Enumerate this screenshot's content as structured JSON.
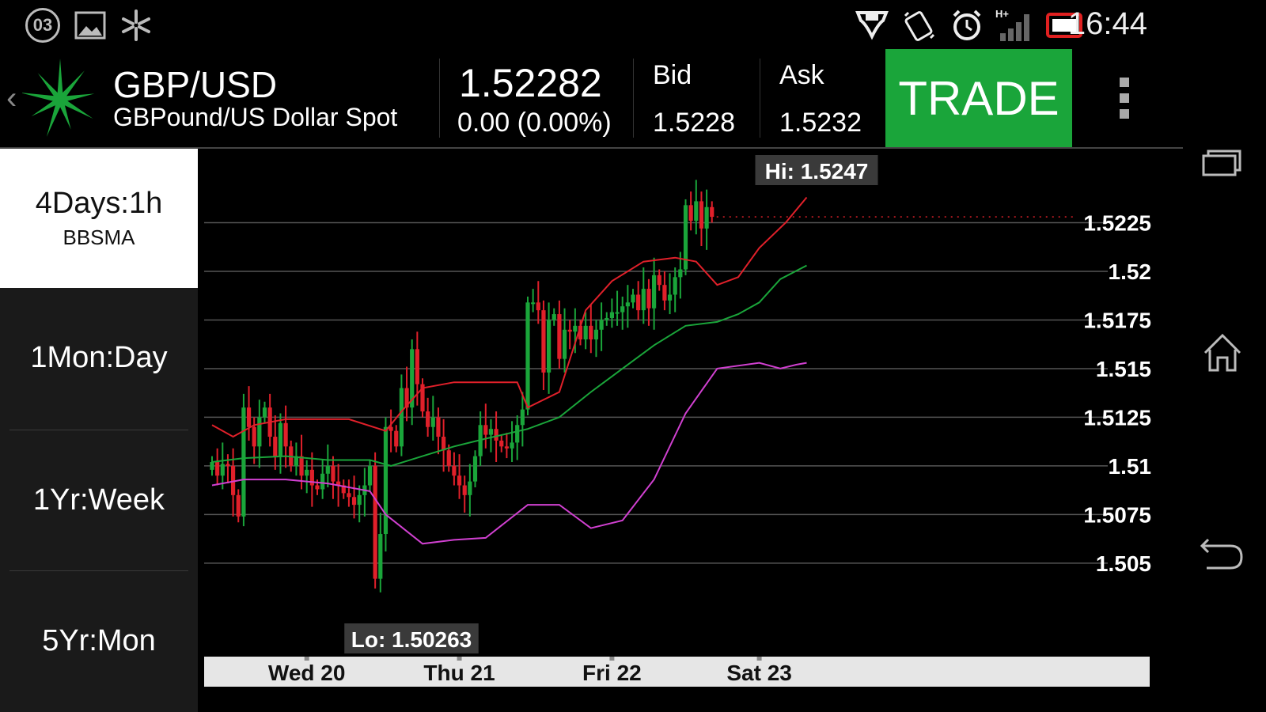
{
  "status_bar": {
    "notification_badge": "03",
    "time": "16:44",
    "network_label": "H+"
  },
  "header": {
    "symbol": "GBP/USD",
    "description": "GBPound/US Dollar Spot",
    "last_price": "1.52282",
    "change": "0.00 (0.00%)",
    "bid_label": "Bid",
    "bid_value": "1.5228",
    "ask_label": "Ask",
    "ask_value": "1.5232",
    "trade_label": "TRADE",
    "trade_color": "#1aa53a"
  },
  "range_menu": [
    {
      "label": "4Days:1h",
      "sub": "BBSMA",
      "active": true
    },
    {
      "label": "1Mon:Day",
      "sub": "",
      "active": false
    },
    {
      "label": "1Yr:Week",
      "sub": "",
      "active": false
    },
    {
      "label": "5Yr:Mon",
      "sub": "",
      "active": false
    }
  ],
  "chart_data": {
    "type": "candlestick",
    "ylim": [
      1.5015,
      1.5263
    ],
    "y_ticks": [
      "1.5225",
      "1.52",
      "1.5175",
      "1.515",
      "1.5125",
      "1.51",
      "1.5075",
      "1.505"
    ],
    "y_tick_values": [
      1.5225,
      1.52,
      1.5175,
      1.515,
      1.5125,
      1.51,
      1.5075,
      1.505
    ],
    "x_labels": [
      "Wed 20",
      "Thu 21",
      "Fri 22",
      "Sat 23"
    ],
    "x_label_candle_index": [
      18,
      47,
      76,
      104
    ],
    "hi_label": "Hi: 1.5247",
    "lo_label": "Lo: 1.50263",
    "last_value": 1.5228,
    "up_color": "#1aa53a",
    "down_color": "#e0202a",
    "upper_band_color": "#e0202a",
    "sma_color": "#1aa53a",
    "lower_band_color": "#d040d0",
    "closes": [
      1.5102,
      1.5095,
      1.5101,
      1.51,
      1.5085,
      1.5074,
      1.513,
      1.512,
      1.511,
      1.5125,
      1.513,
      1.5115,
      1.5105,
      1.5122,
      1.511,
      1.51,
      1.5105,
      1.5095,
      1.5098,
      1.509,
      1.5088,
      1.5096,
      1.51,
      1.5092,
      1.509,
      1.5086,
      1.5084,
      1.508,
      1.5085,
      1.509,
      1.51,
      1.5042,
      1.5065,
      1.512,
      1.5118,
      1.511,
      1.514,
      1.513,
      1.516,
      1.5142,
      1.5128,
      1.512,
      1.5125,
      1.5115,
      1.5108,
      1.51,
      1.5095,
      1.509,
      1.5085,
      1.5092,
      1.5105,
      1.5121,
      1.5116,
      1.5119,
      1.5113,
      1.511,
      1.5109,
      1.5112,
      1.5121,
      1.5129,
      1.5184,
      1.5184,
      1.518,
      1.5148,
      1.5175,
      1.5178,
      1.5155,
      1.517,
      1.5169,
      1.5172,
      1.5165,
      1.5172,
      1.5165,
      1.517,
      1.5175,
      1.5176,
      1.5179,
      1.5179,
      1.5182,
      1.5184,
      1.5188,
      1.518,
      1.5191,
      1.5181,
      1.5198,
      1.5193,
      1.5185,
      1.5188,
      1.5197,
      1.5201,
      1.5234,
      1.5226,
      1.5236,
      1.5222,
      1.5233,
      1.5228
    ],
    "upper_band": [
      [
        0,
        1.5121
      ],
      [
        4,
        1.5115
      ],
      [
        8,
        1.5121
      ],
      [
        14,
        1.5124
      ],
      [
        26,
        1.5124
      ],
      [
        33,
        1.5118
      ],
      [
        36,
        1.5128
      ],
      [
        40,
        1.514
      ],
      [
        46,
        1.5143
      ],
      [
        58,
        1.5143
      ],
      [
        60,
        1.513
      ],
      [
        66,
        1.5138
      ],
      [
        71,
        1.518
      ],
      [
        76,
        1.5195
      ],
      [
        82,
        1.5205
      ],
      [
        88,
        1.5207
      ],
      [
        92,
        1.5205
      ],
      [
        96,
        1.5193
      ],
      [
        100,
        1.5197
      ],
      [
        104,
        1.5212
      ],
      [
        109,
        1.5225
      ],
      [
        113,
        1.5238
      ]
    ],
    "sma": [
      [
        0,
        1.5102
      ],
      [
        6,
        1.5104
      ],
      [
        14,
        1.5105
      ],
      [
        22,
        1.5103
      ],
      [
        30,
        1.5103
      ],
      [
        34,
        1.51
      ],
      [
        40,
        1.5105
      ],
      [
        46,
        1.511
      ],
      [
        52,
        1.5114
      ],
      [
        60,
        1.5119
      ],
      [
        66,
        1.5125
      ],
      [
        72,
        1.5138
      ],
      [
        78,
        1.515
      ],
      [
        84,
        1.5162
      ],
      [
        90,
        1.5172
      ],
      [
        96,
        1.5174
      ],
      [
        100,
        1.5178
      ],
      [
        104,
        1.5184
      ],
      [
        108,
        1.5196
      ],
      [
        113,
        1.5203
      ]
    ],
    "lower_band": [
      [
        0,
        1.509
      ],
      [
        6,
        1.5093
      ],
      [
        14,
        1.5093
      ],
      [
        22,
        1.5091
      ],
      [
        30,
        1.5087
      ],
      [
        33,
        1.5075
      ],
      [
        40,
        1.506
      ],
      [
        46,
        1.5062
      ],
      [
        52,
        1.5063
      ],
      [
        60,
        1.508
      ],
      [
        66,
        1.508
      ],
      [
        72,
        1.5068
      ],
      [
        78,
        1.5072
      ],
      [
        84,
        1.5093
      ],
      [
        90,
        1.5127
      ],
      [
        96,
        1.515
      ],
      [
        104,
        1.5153
      ],
      [
        108,
        1.515
      ],
      [
        111,
        1.5152
      ],
      [
        113,
        1.5153
      ]
    ]
  }
}
